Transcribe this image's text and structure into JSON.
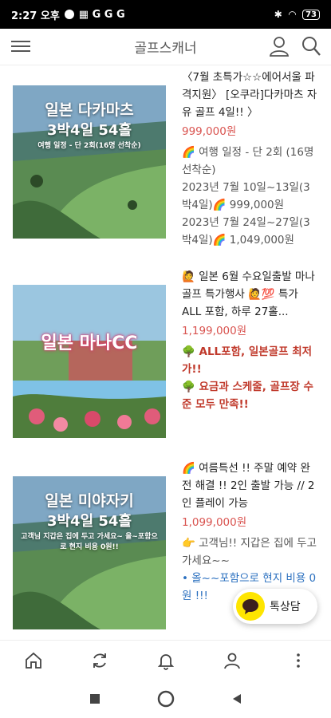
{
  "status": {
    "time": "2:27 오후",
    "battery": "73"
  },
  "header": {
    "title": "골프스캐너"
  },
  "products": [
    {
      "title": "〈7월 초특가☆☆에어서울 파격지원〉 [오쿠라]다카마츠 자유 골프 4일!! 〉",
      "price": "999,000원",
      "lines": [
        "🌈 여행 일정 - 단 2회 (16명 선착순)",
        "2023년 7월 10일~13일(3박4일)🌈 999,000원",
        "2023년 7월 24일~27일(3박4일)🌈 1,049,000원"
      ],
      "banner": {
        "line1": "일본 다카마츠",
        "line2": "3박4일 54홀",
        "line3": "여행 일정 - 단 2회(16명 선착순)"
      }
    },
    {
      "title": "🙋 일본 6월 수요일출발 마나골프 특가행사 🙋💯 특가 ALL 포함, 하루 27홀...",
      "price": "1,199,000원",
      "lines": [
        "🌳 ALL포함, 일본골프 최저가!!",
        "🌳 요금과 스케줄, 골프장 수준 모두 만족!!"
      ],
      "banner": {
        "line1": "일본 마나CC"
      }
    },
    {
      "title": "🌈 여름특선 !! 주말 예약 완전 해결 !! 2인 출발 가능 // 2인 플레이 가능",
      "price": "1,099,000원",
      "lines": [
        "👉 고객님!! 지갑은 집에 두고 가세요~~",
        "• 올~~포함으로 현지 비용 0원 !!!"
      ],
      "banner": {
        "line1": "일본 미야자키",
        "line2": "3박4일 54홀",
        "line3": "고객님 지갑은 집에 두고 가세요~ 올~포함으로 현지 비용 0원!!"
      }
    }
  ],
  "chat": {
    "label": "톡상담"
  },
  "icons": {
    "menu": "menu-icon",
    "user": "user-icon",
    "search": "search-icon",
    "home": "home-icon",
    "refresh": "refresh-icon",
    "bell": "bell-icon",
    "profile": "profile-icon",
    "more": "more-icon"
  }
}
